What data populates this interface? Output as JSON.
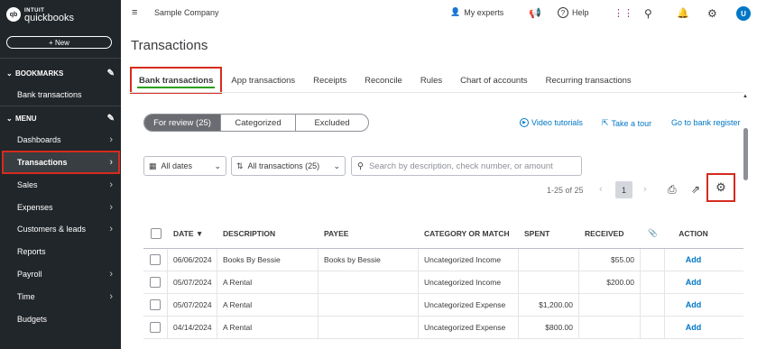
{
  "brand": {
    "badge": "qb",
    "line1": "INTUIT",
    "line2": "quickbooks"
  },
  "sidebar": {
    "new_label": "+ New",
    "bookmarks_label": "BOOKMARKS",
    "bookmark_items": [
      {
        "label": "Bank transactions"
      }
    ],
    "menu_label": "MENU",
    "items": [
      {
        "label": "Dashboards",
        "has_arrow": true
      },
      {
        "label": "Transactions",
        "has_arrow": true,
        "active": true
      },
      {
        "label": "Sales",
        "has_arrow": true
      },
      {
        "label": "Expenses",
        "has_arrow": true
      },
      {
        "label": "Customers & leads",
        "has_arrow": true
      },
      {
        "label": "Reports",
        "has_arrow": false
      },
      {
        "label": "Payroll",
        "has_arrow": true
      },
      {
        "label": "Time",
        "has_arrow": true
      },
      {
        "label": "Budgets",
        "has_arrow": false
      }
    ]
  },
  "topbar": {
    "company": "Sample Company",
    "my_experts": "My experts",
    "help": "Help",
    "avatar_letter": "U"
  },
  "page": {
    "title": "Transactions"
  },
  "tabs": [
    {
      "label": "Bank transactions",
      "active": true
    },
    {
      "label": "App transactions"
    },
    {
      "label": "Receipts"
    },
    {
      "label": "Reconcile"
    },
    {
      "label": "Rules"
    },
    {
      "label": "Chart of accounts"
    },
    {
      "label": "Recurring transactions"
    }
  ],
  "segments": [
    "For review (25)",
    "Categorized",
    "Excluded"
  ],
  "links": {
    "video_tutorials": "Video tutorials",
    "take_a_tour": "Take a tour",
    "go_to_bank_register": "Go to bank register"
  },
  "filters": {
    "dates": "All dates",
    "transactions": "All transactions (25)",
    "search_placeholder": "Search by description, check number, or amount"
  },
  "pagination": {
    "range": "1-25 of 25",
    "page": "1"
  },
  "table": {
    "columns": {
      "date": "DATE",
      "description": "DESCRIPTION",
      "payee": "PAYEE",
      "category": "CATEGORY OR MATCH",
      "spent": "SPENT",
      "received": "RECEIVED",
      "action": "ACTION"
    },
    "rows": [
      {
        "date": "06/06/2024",
        "description": "Books By Bessie",
        "payee": "Books by Bessie",
        "category": "Uncategorized Income",
        "spent": "",
        "received": "$55.00",
        "action": "Add"
      },
      {
        "date": "05/07/2024",
        "description": "A Rental",
        "payee": "",
        "category": "Uncategorized Income",
        "spent": "",
        "received": "$200.00",
        "action": "Add"
      },
      {
        "date": "05/07/2024",
        "description": "A Rental",
        "payee": "",
        "category": "Uncategorized Expense",
        "spent": "$1,200.00",
        "received": "",
        "action": "Add"
      },
      {
        "date": "04/14/2024",
        "description": "A Rental",
        "payee": "",
        "category": "Uncategorized Expense",
        "spent": "$800.00",
        "received": "",
        "action": "Add"
      }
    ]
  }
}
